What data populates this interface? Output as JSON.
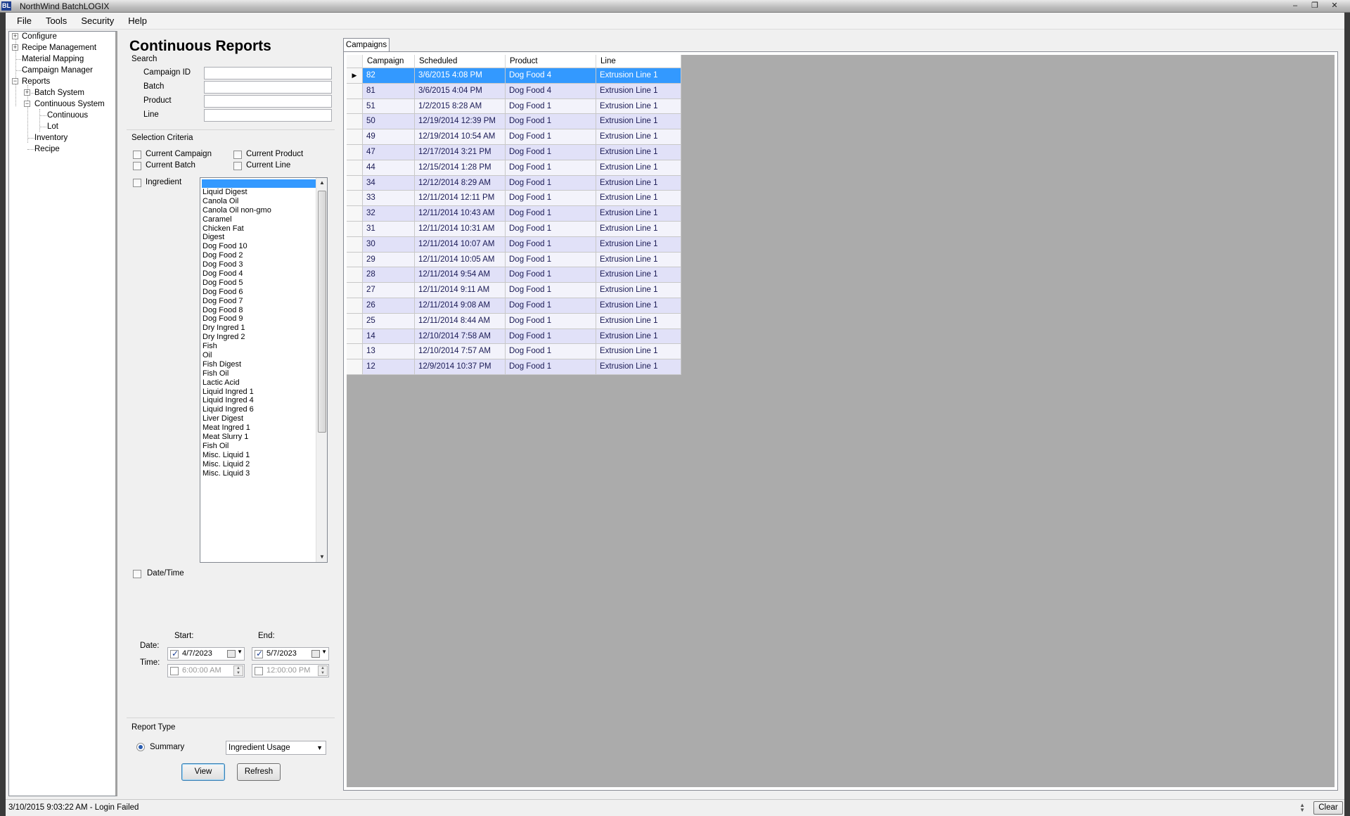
{
  "window": {
    "icon_text": "BL",
    "title": "NorthWind BatchLOGIX",
    "minimize": "–",
    "restore": "❐",
    "close": "✕"
  },
  "menu": [
    "File",
    "Tools",
    "Security",
    "Help"
  ],
  "tree": {
    "configure": "Configure",
    "recipe_management": "Recipe Management",
    "material_mapping": "Material Mapping",
    "campaign_manager": "Campaign Manager",
    "reports": "Reports",
    "batch_system": "Batch System",
    "continuous_system": "Continuous System",
    "continuous": "Continuous",
    "lot": "Lot",
    "inventory": "Inventory",
    "recipe": "Recipe"
  },
  "panel": {
    "title": "Continuous Reports",
    "search_label": "Search",
    "fields": {
      "campaign_id": {
        "label": "Campaign ID",
        "value": ""
      },
      "batch": {
        "label": "Batch",
        "value": ""
      },
      "product": {
        "label": "Product",
        "value": ""
      },
      "line": {
        "label": "Line",
        "value": ""
      }
    },
    "selection_label": "Selection Criteria",
    "criteria": {
      "current_campaign": "Current Campaign",
      "current_product": "Current Product",
      "current_batch": "Current Batch",
      "current_line": "Current Line",
      "ingredient": "Ingredient"
    },
    "ingredients": [
      "Liquid Digest",
      "Canola Oil",
      "Canola Oil non-gmo",
      "Caramel",
      "Chicken Fat",
      "Digest",
      "Dog Food 10",
      "Dog Food 2",
      "Dog Food 3",
      "Dog Food 4",
      "Dog Food 5",
      "Dog Food 6",
      "Dog Food 7",
      "Dog Food 8",
      "Dog Food 9",
      "Dry Ingred 1",
      "Dry Ingred 2",
      "Fish",
      "Oil",
      "Fish Digest",
      "Fish Oil",
      "Lactic Acid",
      "Liquid Ingred 1",
      "Liquid Ingred 4",
      "Liquid Ingred 6",
      "Liver Digest",
      "Meat Ingred 1",
      "Meat Slurry 1",
      "Fish Oil",
      "Misc. Liquid 1",
      "Misc. Liquid 2",
      "Misc. Liquid 3"
    ],
    "datetime_label": "Date/Time",
    "start_label": "Start:",
    "end_label": "End:",
    "date_label": "Date:",
    "time_label": "Time:",
    "start_date": "4/7/2023",
    "end_date": "5/7/2023",
    "start_time": "6:00:00 AM",
    "end_time": "12:00:00 PM",
    "report_type_label": "Report Type",
    "summary_label": "Summary",
    "report_option": "Ingredient Usage",
    "view_button": "View",
    "refresh_button": "Refresh"
  },
  "tab": {
    "label": "Campaigns"
  },
  "grid": {
    "columns": [
      "Campaign",
      "Scheduled",
      "Product",
      "Line"
    ],
    "rows": [
      [
        "82",
        "3/6/2015 4:08 PM",
        "Dog Food 4",
        "Extrusion Line 1"
      ],
      [
        "81",
        "3/6/2015 4:04 PM",
        "Dog Food 4",
        "Extrusion Line 1"
      ],
      [
        "51",
        "1/2/2015 8:28 AM",
        "Dog Food 1",
        "Extrusion Line 1"
      ],
      [
        "50",
        "12/19/2014 12:39 PM",
        "Dog Food 1",
        "Extrusion Line 1"
      ],
      [
        "49",
        "12/19/2014 10:54 AM",
        "Dog Food 1",
        "Extrusion Line 1"
      ],
      [
        "47",
        "12/17/2014 3:21 PM",
        "Dog Food 1",
        "Extrusion Line 1"
      ],
      [
        "44",
        "12/15/2014 1:28 PM",
        "Dog Food 1",
        "Extrusion Line 1"
      ],
      [
        "34",
        "12/12/2014 8:29 AM",
        "Dog Food 1",
        "Extrusion Line 1"
      ],
      [
        "33",
        "12/11/2014 12:11 PM",
        "Dog Food 1",
        "Extrusion Line 1"
      ],
      [
        "32",
        "12/11/2014 10:43 AM",
        "Dog Food 1",
        "Extrusion Line 1"
      ],
      [
        "31",
        "12/11/2014 10:31 AM",
        "Dog Food 1",
        "Extrusion Line 1"
      ],
      [
        "30",
        "12/11/2014 10:07 AM",
        "Dog Food 1",
        "Extrusion Line 1"
      ],
      [
        "29",
        "12/11/2014 10:05 AM",
        "Dog Food 1",
        "Extrusion Line 1"
      ],
      [
        "28",
        "12/11/2014 9:54 AM",
        "Dog Food 1",
        "Extrusion Line 1"
      ],
      [
        "27",
        "12/11/2014 9:11 AM",
        "Dog Food 1",
        "Extrusion Line 1"
      ],
      [
        "26",
        "12/11/2014 9:08 AM",
        "Dog Food 1",
        "Extrusion Line 1"
      ],
      [
        "25",
        "12/11/2014 8:44 AM",
        "Dog Food 1",
        "Extrusion Line 1"
      ],
      [
        "14",
        "12/10/2014 7:58 AM",
        "Dog Food 1",
        "Extrusion Line 1"
      ],
      [
        "13",
        "12/10/2014 7:57 AM",
        "Dog Food 1",
        "Extrusion Line 1"
      ],
      [
        "12",
        "12/9/2014 10:37 PM",
        "Dog Food 1",
        "Extrusion Line 1"
      ]
    ],
    "selected_row": 0
  },
  "status": {
    "message": "3/10/2015 9:03:22 AM - Login Failed",
    "clear_button": "Clear"
  },
  "colors": {
    "selection": "#3399ff",
    "row_even": "#e1e1f8",
    "row_odd": "#f3f3fb",
    "grid_background": "#ababab"
  }
}
